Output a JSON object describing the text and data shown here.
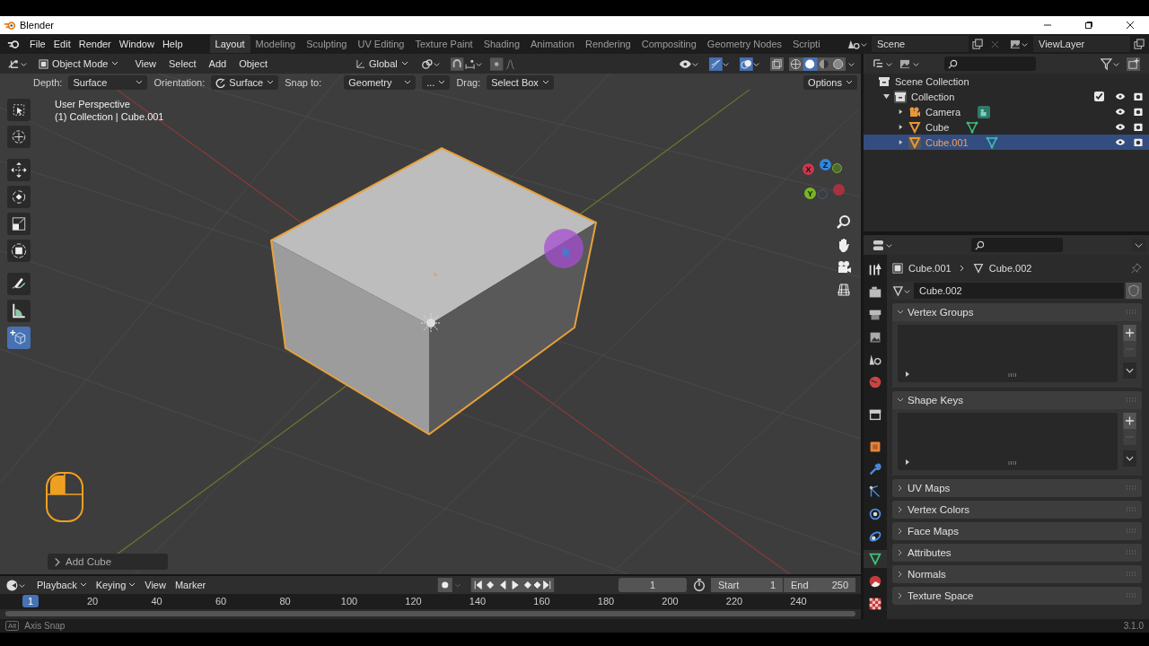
{
  "window": {
    "title": "Blender"
  },
  "menu": [
    "File",
    "Edit",
    "Render",
    "Window",
    "Help"
  ],
  "workspaces": [
    {
      "label": "Layout",
      "selected": true
    },
    {
      "label": "Modeling",
      "selected": false
    },
    {
      "label": "Sculpting",
      "selected": false
    },
    {
      "label": "UV Editing",
      "selected": false
    },
    {
      "label": "Texture Paint",
      "selected": false
    },
    {
      "label": "Shading",
      "selected": false
    },
    {
      "label": "Animation",
      "selected": false
    },
    {
      "label": "Rendering",
      "selected": false
    },
    {
      "label": "Compositing",
      "selected": false
    },
    {
      "label": "Geometry Nodes",
      "selected": false
    },
    {
      "label": "Scripti",
      "selected": false
    }
  ],
  "scene": "Scene",
  "view_layer": "ViewLayer",
  "viewport": {
    "mode": "Object Mode",
    "menus": [
      "View",
      "Select",
      "Add",
      "Object"
    ],
    "orientation": "Global",
    "tool_settings": {
      "depth_label": "Depth:",
      "depth": "Surface",
      "orientation_label": "Orientation:",
      "orientation": "Surface",
      "snap_label": "Snap to:",
      "snap": "Geometry",
      "snap_extra": "...",
      "drag_label": "Drag:",
      "drag": "Select Box",
      "options": "Options"
    },
    "overlay_text": [
      "User Perspective",
      "(1) Collection | Cube.001"
    ],
    "tools": [
      {
        "selected": false
      },
      {
        "selected": false
      },
      {
        "selected": false
      },
      {
        "selected": false
      },
      {
        "selected": false
      },
      {
        "selected": false
      },
      {
        "selected": false
      },
      {
        "selected": false
      },
      {
        "selected": true
      }
    ],
    "axes": [
      "X",
      "Y",
      "Z"
    ],
    "last_operator": "Add Cube"
  },
  "outliner": {
    "root": "Scene Collection",
    "items": [
      {
        "label": "Collection",
        "expanded": true,
        "checked": true,
        "children": [
          {
            "label": "Camera",
            "expanded": false,
            "selected": false
          },
          {
            "label": "Cube",
            "expanded": false,
            "selected": false
          },
          {
            "label": "Cube.001",
            "expanded": false,
            "selected": true
          }
        ]
      }
    ]
  },
  "properties": {
    "breadcrumb": [
      "Cube.001",
      "Cube.002"
    ],
    "data_name": "Cube.002",
    "tabs": [
      {
        "selected": false
      },
      {
        "selected": false
      },
      {
        "selected": false
      },
      {
        "selected": false
      },
      {
        "selected": false
      },
      {
        "selected": false
      },
      {
        "selected": false
      },
      {
        "selected": false
      },
      {
        "selected": false
      },
      {
        "selected": false
      },
      {
        "selected": false
      },
      {
        "selected": false
      },
      {
        "selected": true
      },
      {
        "selected": false
      },
      {
        "selected": false
      }
    ],
    "panels": [
      {
        "title": "Vertex Groups",
        "expanded": true
      },
      {
        "title": "Shape Keys",
        "expanded": true
      },
      {
        "title": "UV Maps",
        "expanded": false
      },
      {
        "title": "Vertex Colors",
        "expanded": false
      },
      {
        "title": "Face Maps",
        "expanded": false
      },
      {
        "title": "Attributes",
        "expanded": false
      },
      {
        "title": "Normals",
        "expanded": false
      },
      {
        "title": "Texture Space",
        "expanded": false
      }
    ]
  },
  "timeline": {
    "menus": [
      "Playback",
      "Keying",
      "View",
      "Marker"
    ],
    "current_frame": "1",
    "start_label": "Start",
    "start": "1",
    "end_label": "End",
    "end": "250",
    "marker": "1",
    "ruler": [
      "20",
      "40",
      "60",
      "80",
      "100",
      "120",
      "140",
      "160",
      "180",
      "200",
      "220",
      "240"
    ]
  },
  "status_bar": {
    "key": "Alt",
    "hint": "Axis Snap",
    "version": "3.1.0"
  }
}
